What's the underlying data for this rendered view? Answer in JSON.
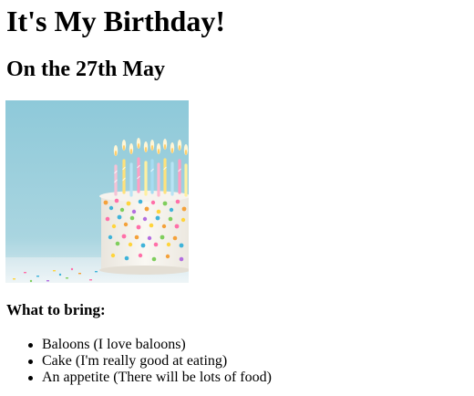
{
  "page": {
    "heading": "It's My Birthday!",
    "subheading": "On the 27th May",
    "image": {
      "icon": "birthday-cake-image",
      "colors": {
        "background": "#9ccfdc",
        "cake": "#f3f0ea",
        "table": "#dbe9ef"
      }
    },
    "bring_heading": "What to bring:",
    "bring_items": [
      "Baloons (I love baloons)",
      "Cake (I'm really good at eating)",
      "An appetite (There will be lots of food)"
    ]
  }
}
